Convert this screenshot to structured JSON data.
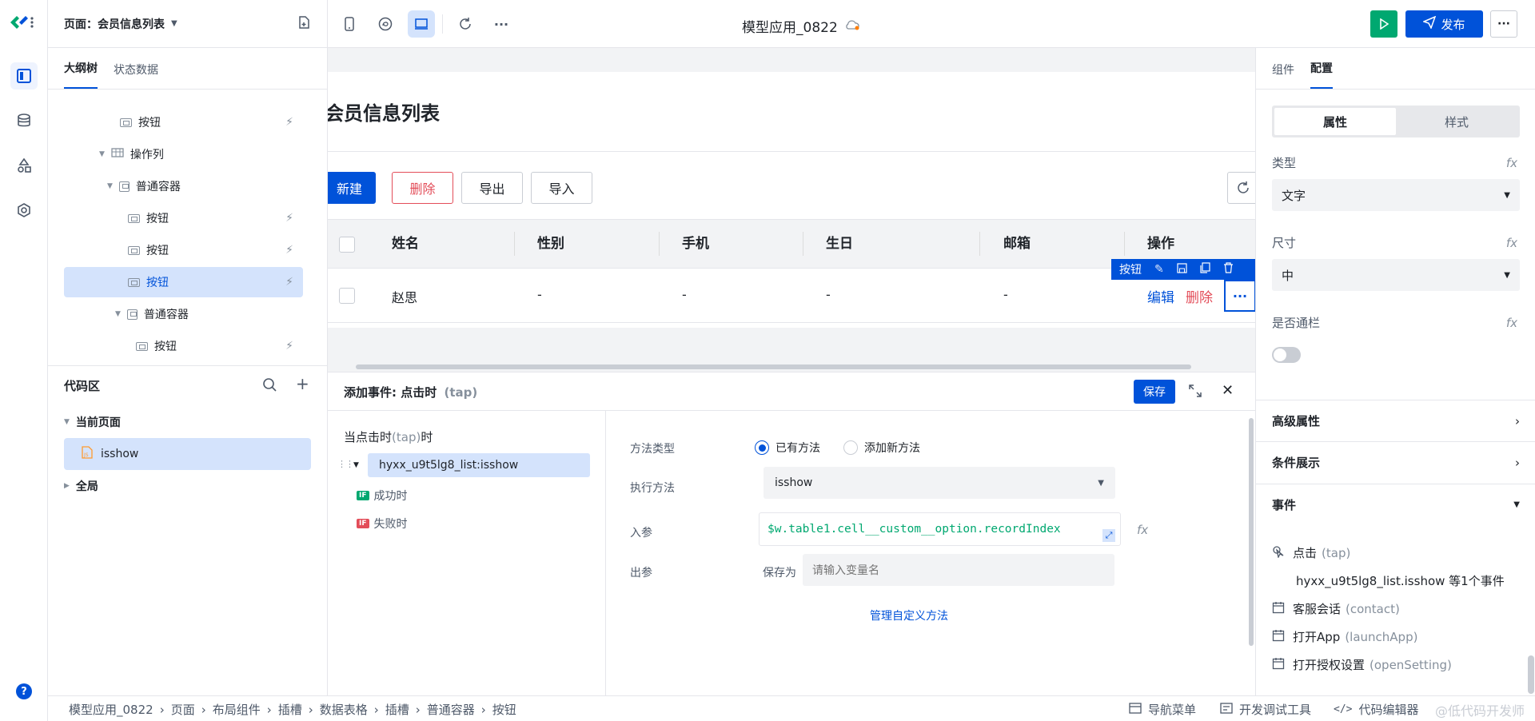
{
  "topbar": {
    "page_selector": "页面：会员信息列表",
    "app_title": "模型应用_0822",
    "publish_label": "发布"
  },
  "left_panel": {
    "tabs": [
      "大纲树",
      "状态数据"
    ],
    "tree": [
      {
        "label": "按钮",
        "type": "button"
      },
      {
        "label": "操作列",
        "type": "table-col"
      },
      {
        "label": "普通容器",
        "type": "container"
      },
      {
        "label": "按钮",
        "type": "button"
      },
      {
        "label": "按钮",
        "type": "button"
      },
      {
        "label": "按钮",
        "type": "button",
        "selected": true
      },
      {
        "label": "普通容器",
        "type": "container"
      },
      {
        "label": "按钮",
        "type": "button"
      }
    ],
    "code_area": {
      "title": "代码区",
      "current_page": "当前页面",
      "file": "isshow",
      "global": "全局"
    }
  },
  "canvas": {
    "page_heading": "会员信息列表",
    "toolbar": {
      "new": "新建",
      "delete": "删除",
      "export": "导出",
      "import": "导入"
    },
    "table": {
      "headers": [
        "姓名",
        "性别",
        "手机",
        "生日",
        "邮箱",
        "操作"
      ],
      "row": [
        "赵思",
        "-",
        "-",
        "-",
        "-"
      ],
      "ops": {
        "edit": "编辑",
        "delete": "删除"
      }
    },
    "selection_toolbar_label": "按钮"
  },
  "event_panel": {
    "title": "添加事件: 点击时",
    "title_sub": "(tap)",
    "save": "保存",
    "trigger_label": "当点击时",
    "trigger_sub": "(tap)",
    "trigger_suffix": "时",
    "action": "hyxx_u9t5lg8_list:isshow",
    "success": "成功时",
    "fail": "失败时",
    "method_type_label": "方法类型",
    "method_existing": "已有方法",
    "method_new": "添加新方法",
    "exec_method_label": "执行方法",
    "exec_method_value": "isshow",
    "input_param_label": "入参",
    "input_param_value": "$w.table1.cell__custom__option.recordIndex",
    "output_param_label": "出参",
    "save_as_label": "保存为",
    "var_placeholder": "请输入变量名",
    "manage_link": "管理自定义方法"
  },
  "right_panel": {
    "tabs": [
      "组件",
      "配置"
    ],
    "segment": [
      "属性",
      "样式"
    ],
    "type_label": "类型",
    "type_value": "文字",
    "size_label": "尺寸",
    "size_value": "中",
    "block_label": "是否通栏",
    "block_on": false,
    "sections": [
      "高级属性",
      "条件展示",
      "事件"
    ],
    "events": [
      {
        "name": "点击",
        "sub": "(tap)",
        "icon": "tap-icon"
      },
      {
        "name": "hyxx_u9t5lg8_list.isshow 等1个事件",
        "sub": "",
        "icon": ""
      },
      {
        "name": "客服会话",
        "sub": "(contact)",
        "icon": "calendar-icon"
      },
      {
        "name": "打开App",
        "sub": "(launchApp)",
        "icon": "calendar-icon"
      },
      {
        "name": "打开授权设置",
        "sub": "(openSetting)",
        "icon": "calendar-icon"
      }
    ]
  },
  "breadcrumb": [
    "模型应用_0822",
    "页面",
    "布局组件",
    "插槽",
    "数据表格",
    "插槽",
    "普通容器",
    "按钮"
  ],
  "statusbar": {
    "nav_menu": "导航菜单",
    "dev_tools": "开发调试工具",
    "code_editor": "代码编辑器"
  },
  "watermark": "@低代码开发师"
}
